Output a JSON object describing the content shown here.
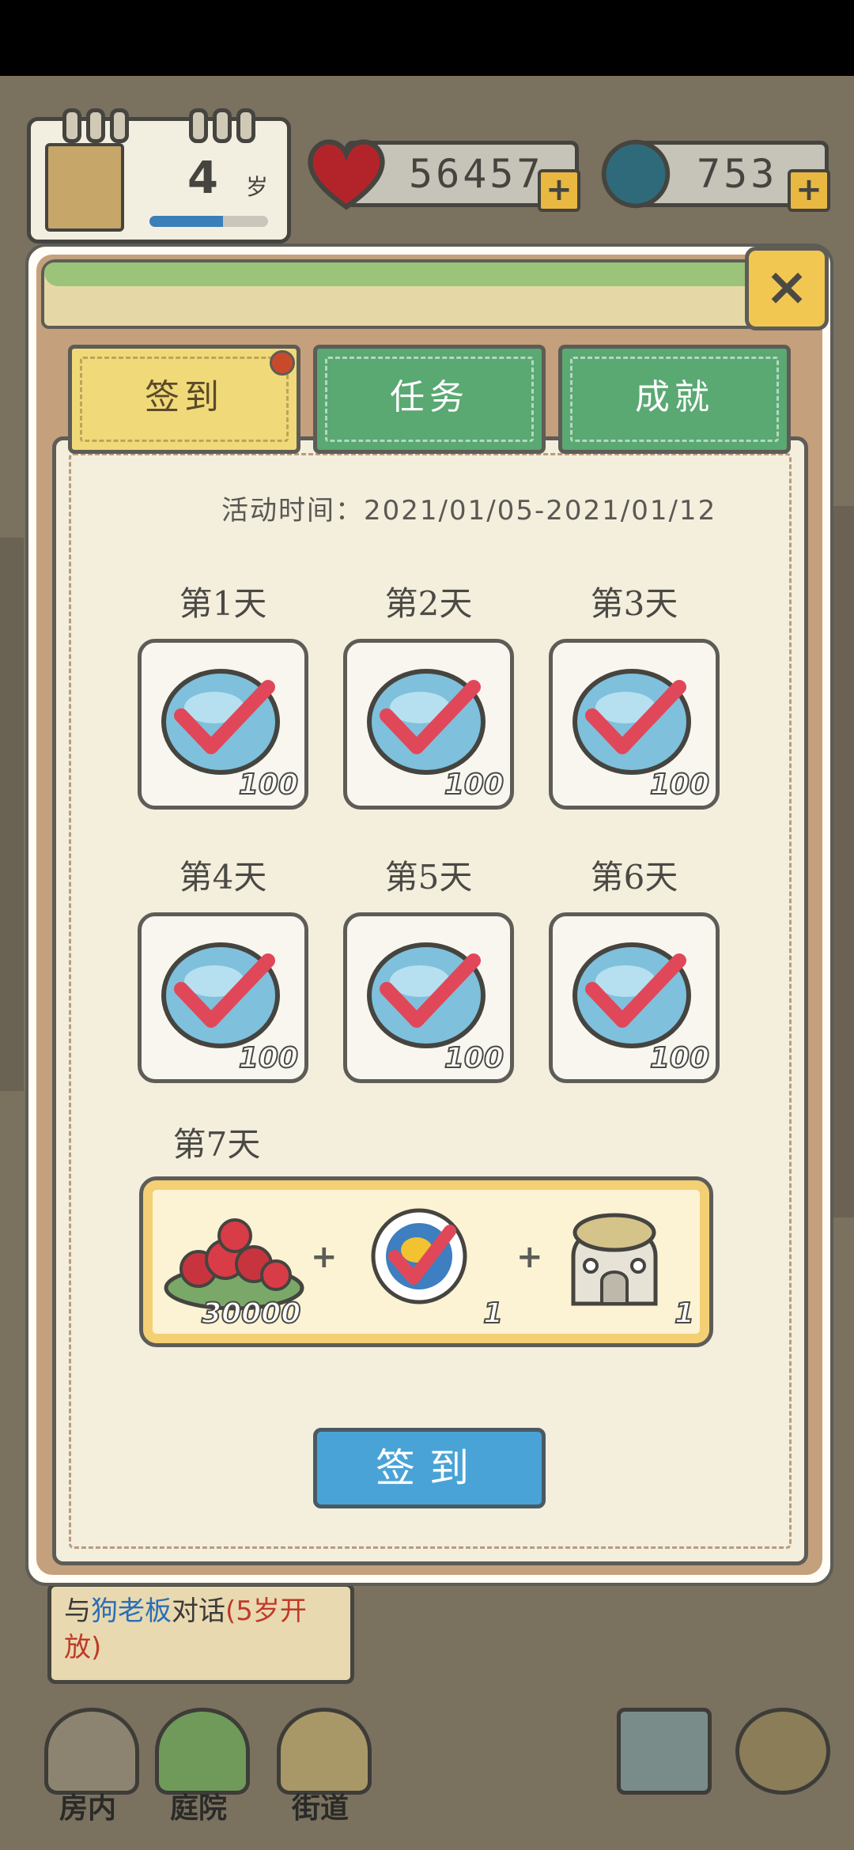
{
  "hud": {
    "age_value": "4",
    "age_unit": "岁",
    "hearts": "56457",
    "caps": "753",
    "plus": "+"
  },
  "dialog": {
    "close_label": "×",
    "tabs": [
      {
        "label": "签到",
        "active": true
      },
      {
        "label": "任务",
        "active": false
      },
      {
        "label": "成就",
        "active": false
      }
    ],
    "event_time": "活动时间：2021/01/05-2021/01/12",
    "days": [
      {
        "label": "第1天",
        "amount": "100"
      },
      {
        "label": "第2天",
        "amount": "100"
      },
      {
        "label": "第3天",
        "amount": "100"
      },
      {
        "label": "第4天",
        "amount": "100"
      },
      {
        "label": "第5天",
        "amount": "100"
      },
      {
        "label": "第6天",
        "amount": "100"
      }
    ],
    "day7": {
      "label": "第7天",
      "plus": "+",
      "rewards": [
        {
          "icon": "hearts-pile-icon",
          "amount": "30000"
        },
        {
          "icon": "fried-egg-plate-icon",
          "amount": "1"
        },
        {
          "icon": "dome-house-icon",
          "amount": "1"
        }
      ]
    },
    "signin_button": "签到"
  },
  "quest_banner": {
    "prefix": "与",
    "name": "狗老板",
    "middle": "对话",
    "suffix": "(5岁开放)"
  },
  "bottom_nav": [
    {
      "label": "房内"
    },
    {
      "label": "庭院"
    },
    {
      "label": "街道"
    }
  ],
  "colors": {
    "tab_active": "#f0d978",
    "tab_inactive": "#5aa872",
    "signin_button": "#4aa3d6",
    "check_red": "#e0485a",
    "cap_blue": "#7fc0dc"
  }
}
